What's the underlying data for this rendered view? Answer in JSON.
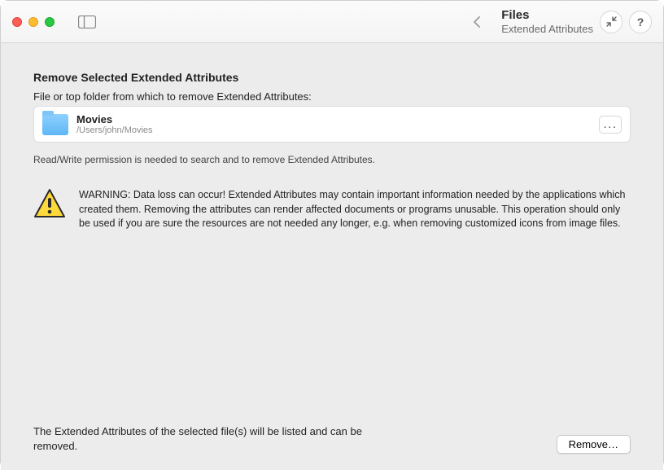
{
  "header": {
    "title": "Files",
    "subtitle": "Extended Attributes"
  },
  "section": {
    "title": "Remove Selected Extended Attributes",
    "prompt": "File or top folder from which to remove Extended Attributes:"
  },
  "file": {
    "name": "Movies",
    "path": "/Users/john/Movies",
    "browse_label": "..."
  },
  "permission_note": "Read/Write permission is needed to search and to remove Extended Attributes.",
  "warning": "WARNING: Data loss can occur! Extended Attributes may contain important information needed by the applications which created them. Removing the attributes can render affected documents or programs unusable. This operation should only be used if you are sure the resources are not needed any longer, e.g. when removing customized icons from image files.",
  "footer": {
    "info": "The Extended Attributes of the selected file(s) will be listed and can be removed.",
    "remove_label": "Remove…"
  }
}
